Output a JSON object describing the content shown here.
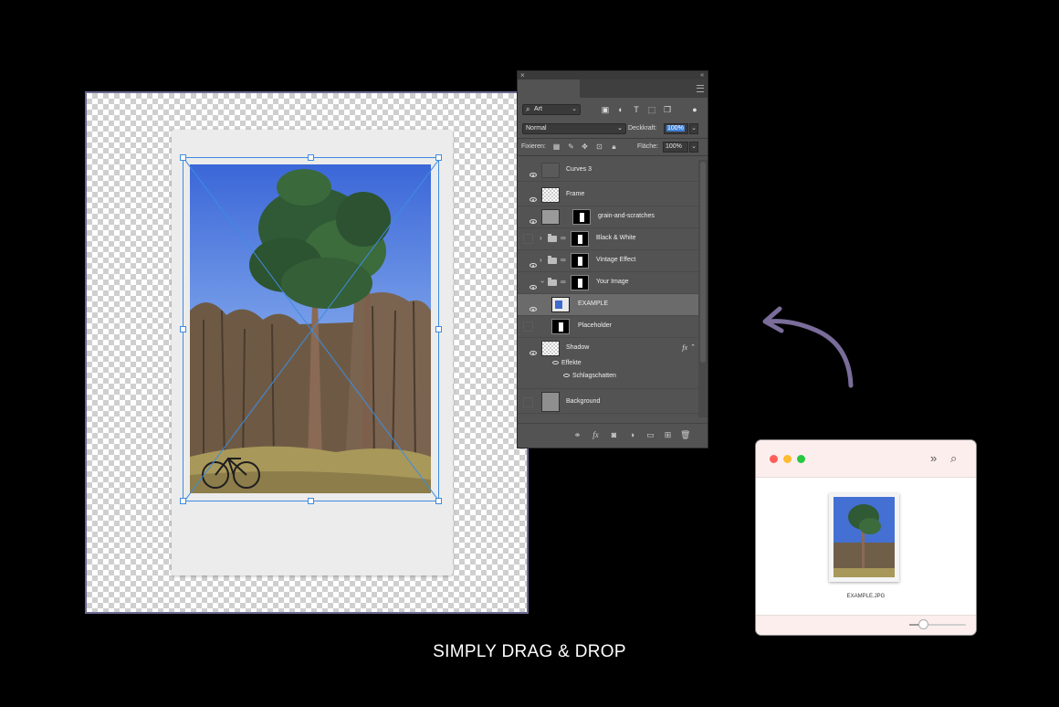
{
  "caption": "SIMPLY DRAG & DROP",
  "layers_panel": {
    "filter": {
      "value": "Art",
      "icon": "search-icon"
    },
    "blend_mode": "Normal",
    "opacity_label": "Deckkraft:",
    "opacity_value": "100%",
    "lock_label": "Fixieren:",
    "fill_label": "Fläche:",
    "fill_value": "100%",
    "layers": [
      {
        "name": "Curves 3",
        "visible": true
      },
      {
        "name": "Frame",
        "visible": true
      },
      {
        "name": "grain-and-scratches",
        "visible": true
      },
      {
        "name": "Black & White",
        "visible": false,
        "type": "group"
      },
      {
        "name": "Vintage Effect",
        "visible": true,
        "type": "group"
      },
      {
        "name": "Your Image",
        "visible": true,
        "type": "group",
        "expanded": true
      },
      {
        "name": "EXAMPLE",
        "visible": true,
        "selected": true
      },
      {
        "name": "Placeholder",
        "visible": false
      },
      {
        "name": "Shadow",
        "visible": true,
        "fx": "fx"
      },
      {
        "name": "Background",
        "visible": false
      }
    ],
    "effects_label": "Effekte",
    "drop_shadow_label": "Schlagschatten"
  },
  "finder": {
    "file_name": "EXAMPLE.JPG",
    "traffic_lights": [
      "#ff5f57",
      "#febc2e",
      "#28c840"
    ]
  },
  "colors": {
    "background": "#000000",
    "panel": "#535353",
    "selection": "#3d8ce0",
    "arrow": "#7a6d9a"
  }
}
